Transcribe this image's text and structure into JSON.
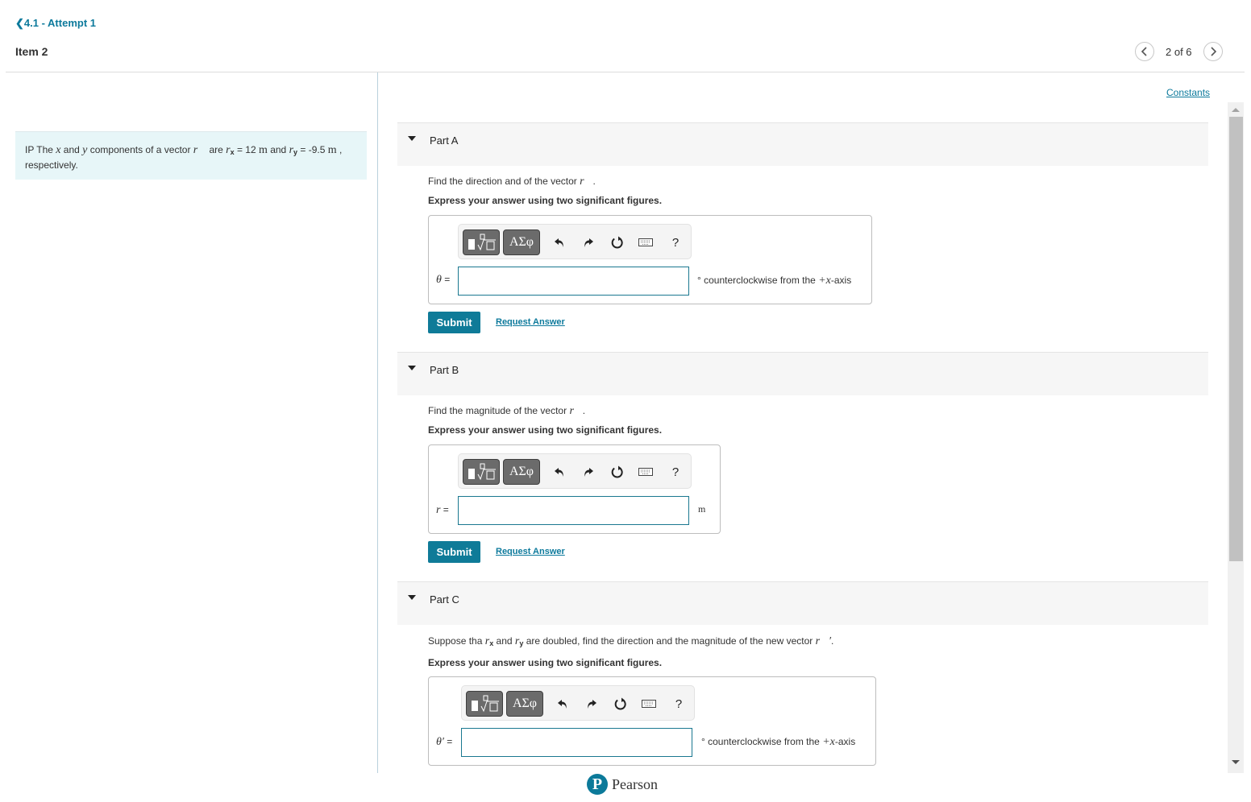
{
  "header": {
    "back_label": "4.1 - Attempt 1",
    "item_title": "Item 2",
    "pager_text": "2 of 6",
    "constants_link": "Constants"
  },
  "intro": {
    "prefix": "IP The ",
    "x_var": "x",
    "and1": " and ",
    "y_var": "y",
    "mid": " components of a vector ",
    "vec": "r⃗",
    "are": " are ",
    "rx_sym": "r",
    "rx_sub": "x",
    "rx_eq": " = 12 ",
    "unit_m": "m",
    "and2": " and ",
    "ry_sym": "r",
    "ry_sub": "y",
    "ry_eq": " = -9.5 ",
    "suffix": " ,",
    "line2": "respectively."
  },
  "toolbar": {
    "templates_icon": "templates-icon",
    "greek_label": "ΑΣφ",
    "undo_icon": "undo-icon",
    "redo_icon": "redo-icon",
    "reset_icon": "reset-icon",
    "keyboard_icon": "keyboard-icon",
    "help_label": "?"
  },
  "parts": [
    {
      "title": "Part A",
      "question": "Find the direction and of the vector ",
      "vec": "r⃗",
      "question_end": ".",
      "instruction": "Express your answer using two significant figures.",
      "answer_label_sym": "θ",
      "answer_label_eq": " =",
      "input_value": "",
      "unit_prefix": "° counterclockwise from the ",
      "unit_math": "+x",
      "unit_suffix": "-axis",
      "submit_label": "Submit",
      "request_label": "Request Answer"
    },
    {
      "title": "Part B",
      "question": "Find the magnitude of the vector ",
      "vec": "r⃗",
      "question_end": ".",
      "instruction": "Express your answer using two significant figures.",
      "answer_label_sym": "r",
      "answer_label_eq": " =",
      "input_value": "",
      "unit": "m",
      "submit_label": "Submit",
      "request_label": "Request Answer"
    },
    {
      "title": "Part C",
      "q_pre": "Suppose tha ",
      "q_rx": "r",
      "q_rx_sub": "x",
      "q_and": " and ",
      "q_ry": "r",
      "q_ry_sub": "y",
      "q_post": " are doubled, find the direction and the magnitude of the new vector ",
      "vec": "r⃗′",
      "question_end": ".",
      "instruction": "Express your answer using two significant figures.",
      "answer_label_sym": "θ′",
      "answer_label_eq": " =",
      "input_value": "",
      "unit_prefix": "° counterclockwise from the ",
      "unit_math": "+x",
      "unit_suffix": "-axis"
    }
  ],
  "footer": {
    "brand_letter": "P",
    "brand_name": "Pearson"
  },
  "colors": {
    "accent": "#0f7b98",
    "intro_bg": "#e7f6f8",
    "part_header_bg": "#f6f6f6"
  }
}
